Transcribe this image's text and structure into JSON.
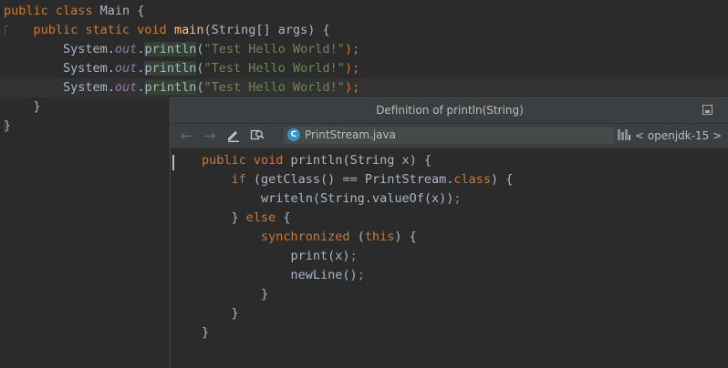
{
  "editor": {
    "lines": [
      {
        "segments": [
          {
            "t": "public class ",
            "c": "kw"
          },
          {
            "t": "Main {",
            "c": "pl"
          }
        ]
      },
      {
        "segments": [
          {
            "t": "    public static void ",
            "c": "kw"
          },
          {
            "t": "main",
            "c": "fn"
          },
          {
            "t": "(String[] args) {",
            "c": "pl"
          }
        ]
      },
      {
        "segments": [
          {
            "t": "        System.",
            "c": "pl"
          },
          {
            "t": "out",
            "c": "fld"
          },
          {
            "t": ".",
            "c": "pl"
          },
          {
            "t": "println",
            "c": "pl hl"
          },
          {
            "t": "(",
            "c": "pl"
          },
          {
            "t": "\"Test Hello World!\"",
            "c": "str"
          },
          {
            "t": ");",
            "c": "kw"
          }
        ]
      },
      {
        "segments": [
          {
            "t": "        System.",
            "c": "pl"
          },
          {
            "t": "out",
            "c": "fld"
          },
          {
            "t": ".",
            "c": "pl"
          },
          {
            "t": "println",
            "c": "pl hl"
          },
          {
            "t": "(",
            "c": "pl"
          },
          {
            "t": "\"Test Hello World!\"",
            "c": "str"
          },
          {
            "t": ");",
            "c": "kw"
          }
        ]
      },
      {
        "segments": [
          {
            "t": "        System.",
            "c": "pl"
          },
          {
            "t": "out",
            "c": "fld"
          },
          {
            "t": ".",
            "c": "pl"
          },
          {
            "t": "println",
            "c": "pl hl"
          },
          {
            "t": "(",
            "c": "pl"
          },
          {
            "t": "\"Test Hello World!\"",
            "c": "str"
          },
          {
            "t": ");",
            "c": "kw"
          }
        ]
      },
      {
        "segments": [
          {
            "t": "    }",
            "c": "pl"
          }
        ]
      },
      {
        "segments": [
          {
            "t": "}",
            "c": "pl"
          }
        ]
      }
    ]
  },
  "popup": {
    "title": "Definition of println(String)",
    "toolbar": {
      "back_icon": "arrow-left-icon",
      "forward_icon": "arrow-right-icon",
      "edit_icon": "pencil-icon",
      "find_usages_icon": "find-usages-icon",
      "file_badge": "C",
      "file_name": "PrintStream.java",
      "library_label": "< openjdk-15 >"
    },
    "code_lines": [
      {
        "segments": [
          {
            "t": "public void ",
            "c": "kw"
          },
          {
            "t": "println(String x) {",
            "c": "pl"
          }
        ]
      },
      {
        "segments": [
          {
            "t": "    if ",
            "c": "kw"
          },
          {
            "t": "(getClass() == PrintStream.",
            "c": "pl"
          },
          {
            "t": "class",
            "c": "kw"
          },
          {
            "t": ") {",
            "c": "pl"
          }
        ]
      },
      {
        "segments": [
          {
            "t": "        writeln(String.",
            "c": "pl"
          },
          {
            "t": "valueOf",
            "c": "pl"
          },
          {
            "t": "(x))",
            "c": "pl"
          },
          {
            "t": ";",
            "c": "kw"
          }
        ]
      },
      {
        "segments": [
          {
            "t": "    } ",
            "c": "pl"
          },
          {
            "t": "else ",
            "c": "kw"
          },
          {
            "t": "{",
            "c": "pl"
          }
        ]
      },
      {
        "segments": [
          {
            "t": "        synchronized ",
            "c": "kw"
          },
          {
            "t": "(",
            "c": "pl"
          },
          {
            "t": "this",
            "c": "kw"
          },
          {
            "t": ") {",
            "c": "pl"
          }
        ]
      },
      {
        "segments": [
          {
            "t": "            print(x)",
            "c": "pl"
          },
          {
            "t": ";",
            "c": "kw"
          }
        ]
      },
      {
        "segments": [
          {
            "t": "            newLine()",
            "c": "pl"
          },
          {
            "t": ";",
            "c": "kw"
          }
        ]
      },
      {
        "segments": [
          {
            "t": "        }",
            "c": "pl"
          }
        ]
      },
      {
        "segments": [
          {
            "t": "    }",
            "c": "pl"
          }
        ]
      },
      {
        "segments": [
          {
            "t": "}",
            "c": "pl"
          }
        ]
      }
    ]
  },
  "colors": {
    "background": "#2b2b2b",
    "keyword": "#cc7832",
    "method_decl": "#ffc66d",
    "string": "#6a8759",
    "static_field": "#9876aa",
    "plain": "#a9b7c6",
    "popup_header": "#3c3f41"
  }
}
